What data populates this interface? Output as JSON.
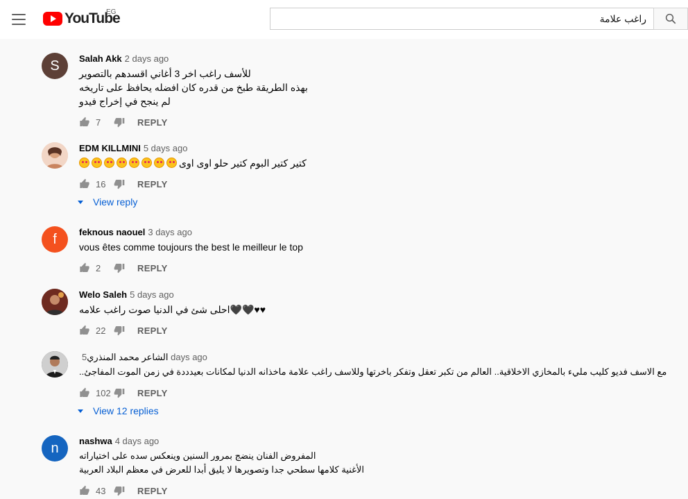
{
  "header": {
    "logo_text": "YouTube",
    "country": "EG",
    "search_value": "راغب علامة"
  },
  "comments": [
    {
      "author": "Salah Akk",
      "time": "2 days ago",
      "avatar_letter": "S",
      "avatar_color": "#5d4037",
      "lines": [
        "للأسف راغب اخر 3 أغاني اقسدهم بالتصوير",
        "بهذه الطريقة طبخ من قدره كان افضله يحافظ على تاريخه",
        "لم ينجح في إخراج فيدو"
      ],
      "likes": "7",
      "reply_label": "REPLY"
    },
    {
      "author": "EDM KILLMINI",
      "time": "5 days ago",
      "avatar_letter": "",
      "avatar_color": "#e8c4b0",
      "lines": [
        "كتير كتير البوم كتير حلو اوى اوى"
      ],
      "emoji_count": 8,
      "likes": "16",
      "reply_label": "REPLY",
      "view_replies": "View reply"
    },
    {
      "author": "feknous naouel",
      "time": "3 days ago",
      "avatar_letter": "f",
      "avatar_color": "#f4511e",
      "lines": [
        "vous êtes comme toujours the best le meilleur le top"
      ],
      "likes": "2",
      "reply_label": "REPLY"
    },
    {
      "author": "Welo Saleh",
      "time": "5 days ago",
      "avatar_letter": "",
      "avatar_color": "#8d3b2a",
      "lines": [
        "♥♥🖤🖤احلى شئ في الدنيا صوت راغب علامه"
      ],
      "likes": "22",
      "reply_label": "REPLY"
    },
    {
      "author": "الشاعر محمد المنذري",
      "time": "5 days ago",
      "avatar_letter": "",
      "avatar_color": "#3b3b3b",
      "lines": [
        "مع الاسف فديو كليب مليء بالمخازي الاخلاقية.. العالم من تكبر تعقل وتفكر باخرتها وللاسف راغب علامة ماخذانه الدنيا لمكانات بعيدددة في زمن الموت المفاجئ.."
      ],
      "likes": "102",
      "reply_label": "REPLY",
      "view_replies": "View 12 replies"
    },
    {
      "author": "nashwa",
      "time": "4 days ago",
      "avatar_letter": "n",
      "avatar_color": "#1565c0",
      "lines": [
        "المفروض الفنان ينضج بمرور السنين وينعكس سده على اختياراته",
        "الأغنية كلامها سطحي جدا وتصويرها لا يليق أبدا للعرض في معظم البلاد العربية"
      ],
      "likes": "43",
      "reply_label": "REPLY"
    }
  ]
}
